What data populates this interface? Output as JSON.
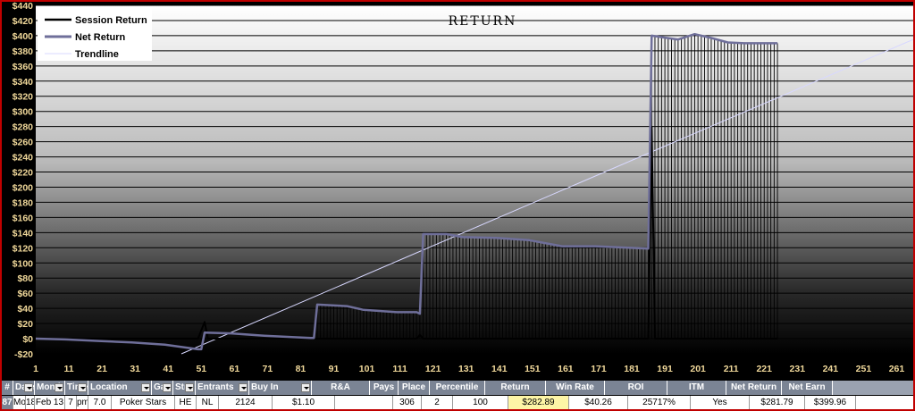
{
  "chart_data": {
    "type": "line",
    "title": "RETURN",
    "xlabel": "",
    "ylabel": "",
    "xlim": [
      1,
      266
    ],
    "ylim": [
      -20,
      440
    ],
    "yticks": [
      -20,
      0,
      20,
      40,
      60,
      80,
      100,
      120,
      140,
      160,
      180,
      200,
      220,
      240,
      260,
      280,
      300,
      320,
      340,
      360,
      380,
      400,
      420,
      440
    ],
    "ytick_labels": [
      "-$20",
      "$0",
      "$20",
      "$40",
      "$60",
      "$80",
      "$100",
      "$120",
      "$140",
      "$160",
      "$180",
      "$200",
      "$220",
      "$240",
      "$260",
      "$280",
      "$300",
      "$320",
      "$340",
      "$360",
      "$380",
      "$400",
      "$420",
      "$440"
    ],
    "xticks": [
      1,
      11,
      21,
      31,
      41,
      51,
      61,
      71,
      81,
      91,
      101,
      111,
      121,
      131,
      141,
      151,
      161,
      171,
      181,
      191,
      201,
      211,
      221,
      231,
      241,
      251,
      261
    ],
    "grid": true,
    "legend_position": "top-left",
    "series": [
      {
        "name": "Session Return",
        "color": "#000000",
        "points": [
          [
            1,
            0
          ],
          [
            50,
            0
          ],
          [
            52,
            22
          ],
          [
            53,
            0
          ],
          [
            85,
            0
          ],
          [
            116,
            0
          ],
          [
            117,
            5
          ],
          [
            118,
            0
          ],
          [
            186,
            0
          ],
          [
            187,
            280
          ],
          [
            188,
            0
          ],
          [
            225,
            0
          ]
        ]
      },
      {
        "name": "Net Return",
        "color": "#6f6f9a",
        "points": [
          [
            1,
            0
          ],
          [
            10,
            -1
          ],
          [
            20,
            -3
          ],
          [
            30,
            -5
          ],
          [
            40,
            -8
          ],
          [
            50,
            -14
          ],
          [
            51,
            -14
          ],
          [
            52,
            8
          ],
          [
            60,
            7
          ],
          [
            70,
            4
          ],
          [
            84,
            1
          ],
          [
            85,
            1
          ],
          [
            86,
            45
          ],
          [
            95,
            43
          ],
          [
            100,
            38
          ],
          [
            110,
            35
          ],
          [
            116,
            35
          ],
          [
            117,
            33
          ],
          [
            118,
            138
          ],
          [
            125,
            138
          ],
          [
            130,
            134
          ],
          [
            140,
            133
          ],
          [
            150,
            130
          ],
          [
            160,
            122
          ],
          [
            170,
            122
          ],
          [
            180,
            120
          ],
          [
            186,
            119
          ],
          [
            187,
            400
          ],
          [
            190,
            398
          ],
          [
            195,
            395
          ],
          [
            200,
            402
          ],
          [
            205,
            397
          ],
          [
            210,
            391
          ],
          [
            215,
            390
          ],
          [
            225,
            390
          ]
        ]
      },
      {
        "name": "Trendline",
        "color": "#d8d8ff",
        "points": [
          [
            45,
            -20
          ],
          [
            266,
            395
          ]
        ]
      }
    ]
  },
  "table": {
    "headers": [
      {
        "label": "#"
      },
      {
        "label": "Date",
        "filter": true
      },
      {
        "label": "Month",
        "filter": true
      },
      {
        "label": "Time",
        "filter": true
      },
      {
        "label": "Location",
        "filter": true
      },
      {
        "label": "Gan",
        "filter": true
      },
      {
        "label": "Stre",
        "filter": true
      },
      {
        "label": "Entrants",
        "filter": true
      },
      {
        "label": "Buy In",
        "filter": true
      },
      {
        "label": "R&A"
      },
      {
        "label": "Pays"
      },
      {
        "label": "Place"
      },
      {
        "label": "Percentile"
      },
      {
        "label": "Return"
      },
      {
        "label": "Win Rate"
      },
      {
        "label": "ROI"
      },
      {
        "label": "ITM"
      },
      {
        "label": "Net Return"
      },
      {
        "label": "Net Earn"
      }
    ],
    "row": [
      "87",
      "Mon",
      "18",
      "Feb 13",
      "7",
      "pm",
      "7.0",
      "Poker Stars",
      "HE",
      "NL",
      "2124",
      "$1.10",
      "",
      "306",
      "2",
      "100",
      "$282.89",
      "$40.26",
      "25717%",
      "Yes",
      "$281.79",
      "$399.96"
    ],
    "highlight_color": "#fdf5a6"
  }
}
